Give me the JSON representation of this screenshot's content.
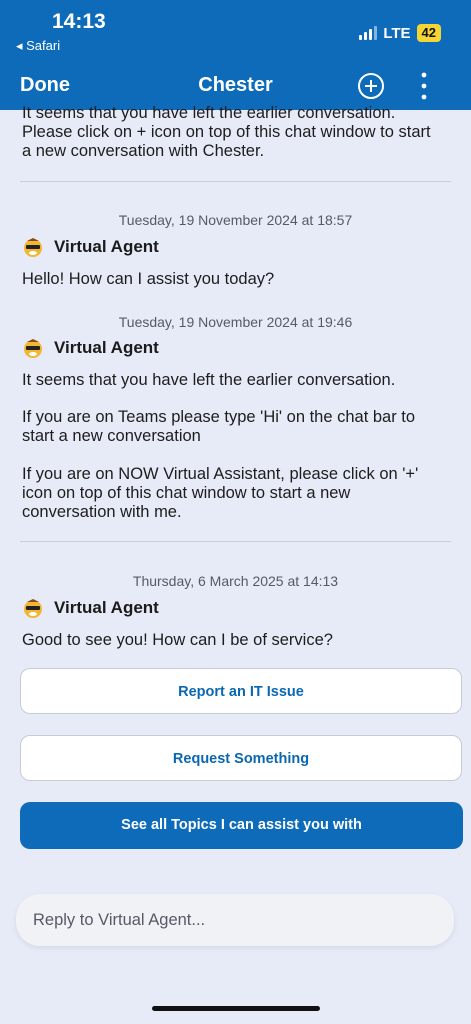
{
  "status_bar": {
    "time": "14:13",
    "back_app": "◂ Safari",
    "network": "LTE",
    "battery": "42"
  },
  "nav": {
    "done_label": "Done",
    "title": "Chester",
    "plus_icon": "plus-circle-icon",
    "more_icon": "more-vertical-icon"
  },
  "conversation": {
    "first_partial": {
      "text": "It seems that you have left the earlier conversation. Please click on + icon on top of this chat window to start a new conversation with Chester."
    },
    "messages": [
      {
        "timestamp": "Tuesday, 19 November 2024 at 18:57",
        "sender": "Virtual Agent",
        "paragraphs": [
          "Hello! How can I assist you today?"
        ]
      },
      {
        "timestamp": "Tuesday, 19 November 2024 at 19:46",
        "sender": "Virtual Agent",
        "paragraphs": [
          "It seems that you have left the earlier conversation.",
          "If you are on Teams please type 'Hi' on the chat bar to start a new conversation",
          "If you are on NOW Virtual Assistant, please click on '+' icon on top of this chat window to start a new conversation with me."
        ]
      },
      {
        "timestamp": "Thursday, 6 March 2025 at 14:13",
        "sender": "Virtual Agent",
        "paragraphs": [
          "Good to see you! How can I be of service?"
        ]
      }
    ]
  },
  "options": [
    {
      "label": "Report an IT Issue"
    },
    {
      "label": "Request Something"
    }
  ],
  "primary_option": {
    "label": "See all Topics I can assist you with"
  },
  "reply": {
    "placeholder": "Reply to Virtual Agent..."
  },
  "colors": {
    "brand_blue": "#0d6bb9",
    "background": "#e7ebf7",
    "battery_badge": "#f5d533"
  }
}
